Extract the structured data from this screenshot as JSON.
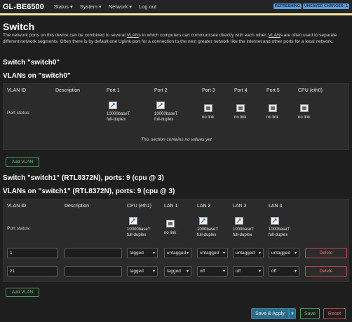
{
  "header": {
    "brand": "GL-BE6500",
    "menu": [
      "Status ▾",
      "System ▾",
      "Network ▾",
      "Log out"
    ],
    "badge_refreshing": "REFRESHING",
    "badge_unsaved": "UNSAVED CHANGES: 1"
  },
  "page": {
    "title": "Switch",
    "description_1": "The network ports on this device can be combined to several ",
    "description_vlans_1": "VLAN",
    "description_2": "s in which computers can communicate directly with each other. ",
    "description_vlans_2": "VLAN",
    "description_3": "s are often used to separate different network segments. Often there is by default one Uplink port for a connection to the next greater network like the internet and other ports for a local network."
  },
  "switch0": {
    "title": "Switch \"switch0\"",
    "vlans_title": "VLANs on \"switch0\"",
    "headers": [
      "VLAN ID",
      "Description",
      "Port 1",
      "Port 2",
      "Port 3",
      "Port 4",
      "Port 5",
      "CPU (eth0)"
    ],
    "port_status_label": "Port status:",
    "ports": [
      {
        "line1": "10000baseT",
        "line2": "full-duplex",
        "link": true
      },
      {
        "line1": "10000baseT",
        "line2": "full-duplex",
        "link": true
      },
      {
        "line1": "no link",
        "line2": "",
        "link": false
      },
      {
        "line1": "no link",
        "line2": "",
        "link": false
      },
      {
        "line1": "no link",
        "line2": "",
        "link": false
      },
      {
        "line1": "no link",
        "line2": "",
        "link": false
      }
    ],
    "empty_note": "This section contains no values yet",
    "add_label": "Add VLAN"
  },
  "switch1": {
    "title": "Switch \"switch1\" (RTL8372N), ports: 9 (cpu @ 3)",
    "vlans_title": "VLANs on \"switch1\" (RTL8372N), ports: 9 (cpu @ 3)",
    "headers": [
      "VLAN ID",
      "Description",
      "CPU (eth1)",
      "LAN 1",
      "LAN 2",
      "LAN 3",
      "LAN 4"
    ],
    "port_status_label": "Port status:",
    "ports": [
      {
        "line1": "10000baseT",
        "line2": "full-duplex",
        "link": true
      },
      {
        "line1": "no link",
        "line2": "",
        "link": false
      },
      {
        "line1": "1000baseT",
        "line2": "full-duplex",
        "link": true
      },
      {
        "line1": "1000baseT",
        "line2": "full-duplex",
        "link": true
      },
      {
        "line1": "1000baseT",
        "line2": "full-duplex",
        "link": true
      }
    ],
    "rows": [
      {
        "vlan_id": "1",
        "description": "",
        "cpu": "tagged",
        "lan1": "untagged",
        "lan2": "untagged",
        "lan3": "untagged",
        "lan4": "untagged",
        "delete": "Delete"
      },
      {
        "vlan_id": "21",
        "description": "",
        "cpu": "tagged",
        "lan1": "tagged",
        "lan2": "off",
        "lan3": "off",
        "lan4": "off",
        "delete": "Delete"
      }
    ],
    "add_label": "Add VLAN"
  },
  "footer": {
    "save_apply": "Save & Apply",
    "save": "Save",
    "reset": "Reset"
  }
}
